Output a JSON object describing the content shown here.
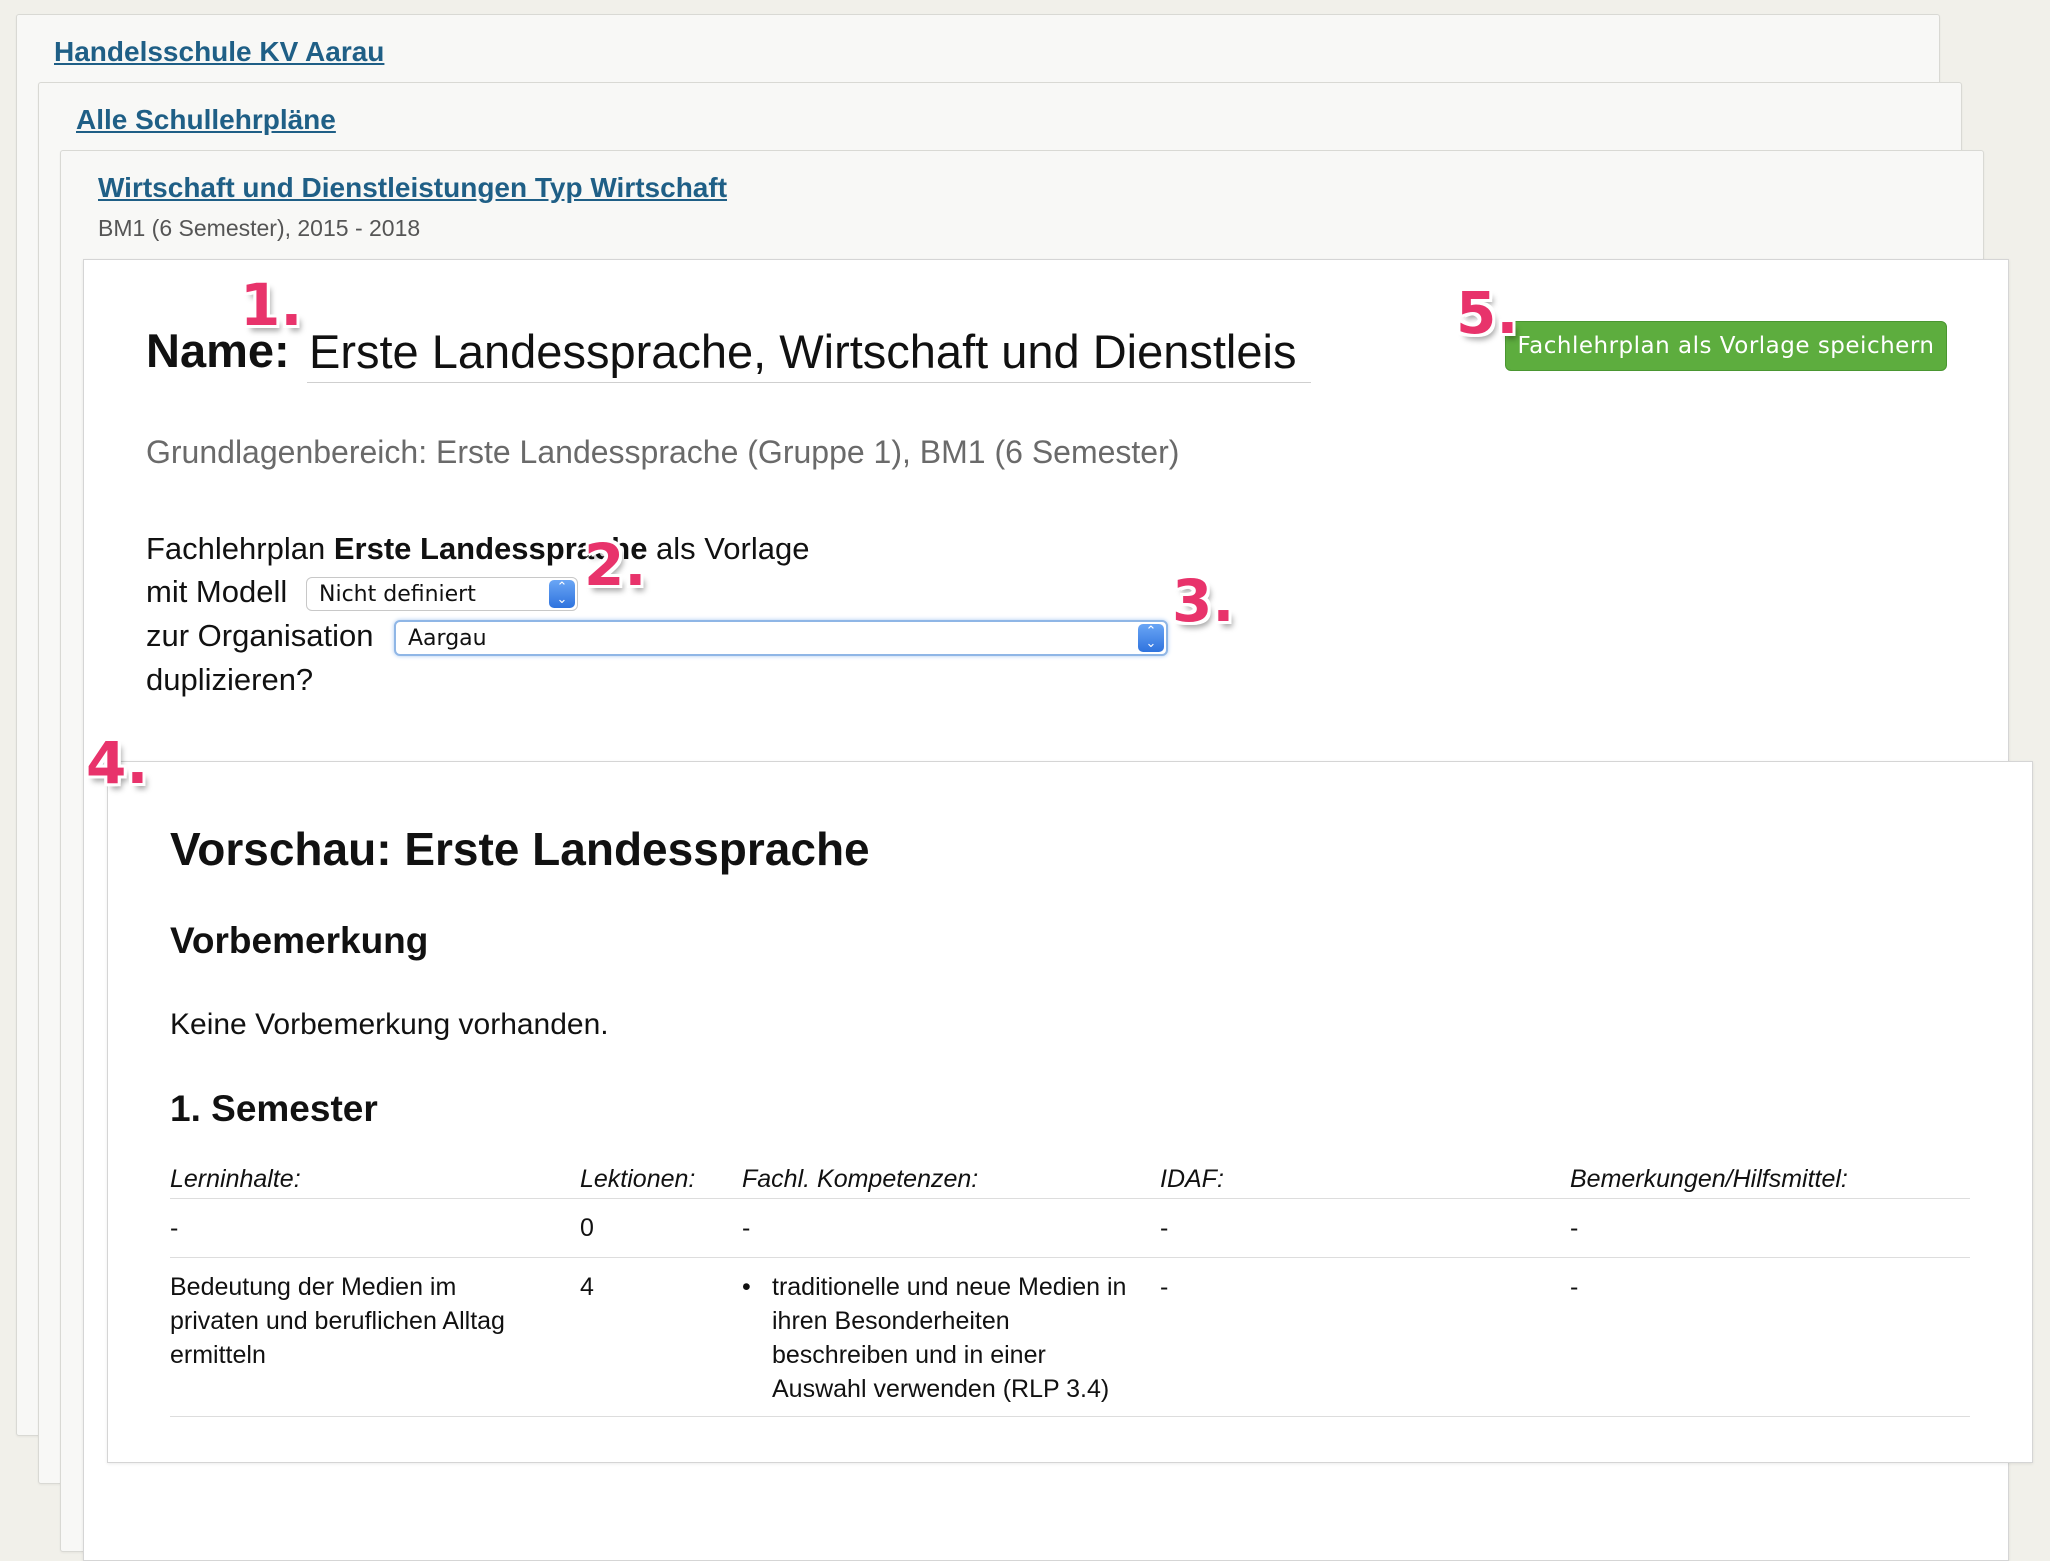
{
  "breadcrumbs": {
    "school": "Handelsschule KV Aarau",
    "all_plans": "Alle Schullehrpläne",
    "plan": "Wirtschaft und Dienstleistungen Typ Wirtschaft",
    "plan_subtitle": "BM1 (6 Semester), 2015 - 2018"
  },
  "form": {
    "name_label": "Name:",
    "name_value": "Erste Landessprache, Wirtschaft und Dienstleis",
    "save_button": "Fachlehrplan als Vorlage speichern",
    "grundlagen": "Grundlagenbereich: Erste Landessprache (Gruppe 1), BM1 (6 Semester)",
    "dup_line1_prefix": "Fachlehrplan ",
    "dup_line1_bold": "Erste Landessprache",
    "dup_line1_suffix": " als Vorlage",
    "dup_line2": "mit Modell",
    "model_selected": "Nicht definiert",
    "dup_line3": "zur Organisation",
    "org_selected": "Aargau",
    "dup_line4": "duplizieren?"
  },
  "preview": {
    "title": "Vorschau: Erste Landessprache",
    "vorbemerkung_heading": "Vorbemerkung",
    "vorbemerkung_text": "Keine Vorbemerkung vorhanden.",
    "semester_heading": "1. Semester",
    "columns": [
      "Lerninhalte:",
      "Lektionen:",
      "Fachl. Kompetenzen:",
      "IDAF:",
      "Bemerkungen/Hilfsmittel:"
    ],
    "rows": [
      {
        "lerninhalte": "-",
        "lektionen": "0",
        "kompetenzen": "-",
        "idaf": "-",
        "bemerkungen": "-"
      },
      {
        "lerninhalte": "Bedeutung der Medien im privaten und beruflichen Alltag ermitteln",
        "lektionen": "4",
        "kompetenzen": "traditionelle und neue Medien in ihren Besonderheiten beschreiben und in einer Auswahl verwenden (RLP 3.4)",
        "idaf": "-",
        "bemerkungen": "-"
      }
    ]
  },
  "markers": [
    "1.",
    "2.",
    "3.",
    "4.",
    "5."
  ],
  "colors": {
    "link": "#1f5f86",
    "save_button": "#5dad3e",
    "marker": "#e8336b",
    "background": "#f1f0ea"
  }
}
